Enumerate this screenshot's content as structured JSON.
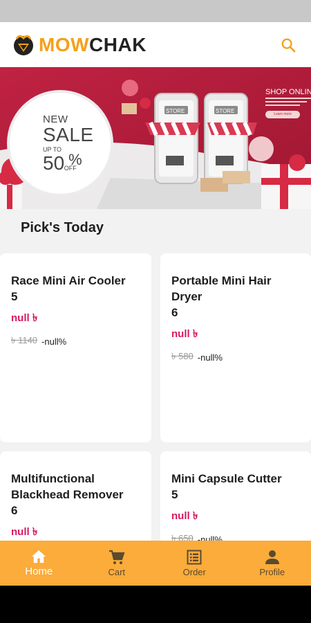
{
  "header": {
    "brand_part1": "MOW",
    "brand_part2": "CHAK",
    "search_icon": "search-icon"
  },
  "banner": {
    "badge_line1": "NEW",
    "badge_line2": "SALE",
    "badge_up_to": "UP TO",
    "badge_value": "50",
    "badge_percent": "%",
    "badge_off": "OFF",
    "shop_text": "SHOP ONLINE",
    "store_label": "STORE",
    "learn_button": "Learn more"
  },
  "section": {
    "title": "Pick's Today"
  },
  "products": [
    {
      "name": "Race Mini Air Cooler",
      "qty": "5",
      "price": "null ৳",
      "old_price": "৳ 1140",
      "discount": "-null%"
    },
    {
      "name": "Portable Mini Hair Dryer",
      "qty": "6",
      "price": "null ৳",
      "old_price": "৳ 580",
      "discount": "-null%"
    },
    {
      "name": "Multifunctional Blackhead Remover",
      "qty": "6",
      "price": "null ৳",
      "old_price": "",
      "discount": ""
    },
    {
      "name": "Mini Capsule Cutter",
      "qty": "5",
      "price": "null ৳",
      "old_price": "৳ 650",
      "discount": "-null%"
    }
  ],
  "bottom_nav": [
    {
      "label": "Home",
      "icon": "home-icon",
      "active": true
    },
    {
      "label": "Cart",
      "icon": "cart-icon",
      "active": false
    },
    {
      "label": "Order",
      "icon": "order-icon",
      "active": false
    },
    {
      "label": "Profile",
      "icon": "profile-icon",
      "active": false
    }
  ],
  "colors": {
    "brand_orange": "#f5a01a",
    "nav_bg": "#fbac3a",
    "price_pink": "#d81b60",
    "banner_red": "#b51e3a"
  }
}
